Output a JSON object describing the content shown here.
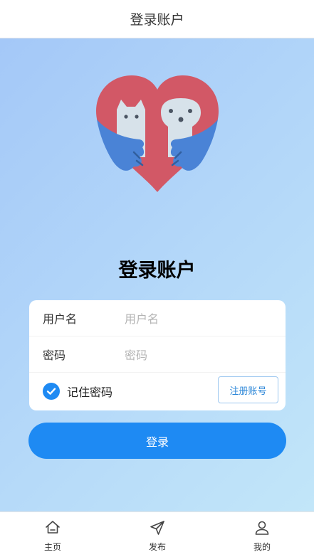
{
  "header": {
    "title": "登录账户"
  },
  "main": {
    "title": "登录账户"
  },
  "form": {
    "username": {
      "label": "用户名",
      "placeholder": "用户名",
      "value": ""
    },
    "password": {
      "label": "密码",
      "placeholder": "密码",
      "value": ""
    },
    "remember": {
      "label": "记住密码",
      "checked": true
    },
    "register_label": "注册账号",
    "login_label": "登录"
  },
  "tabbar": {
    "items": [
      {
        "label": "主页",
        "icon": "home-icon"
      },
      {
        "label": "发布",
        "icon": "send-icon"
      },
      {
        "label": "我的",
        "icon": "user-icon"
      }
    ]
  },
  "colors": {
    "accent": "#1e8af3",
    "heart": "#d25866",
    "hands": "#4a83d6",
    "pets": "#d7e2ea"
  }
}
